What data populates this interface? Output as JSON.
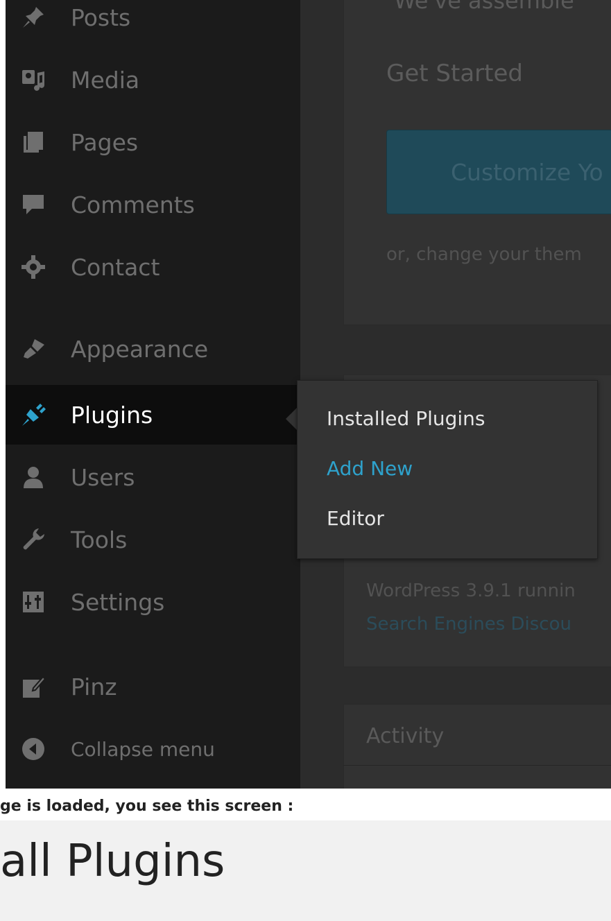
{
  "sidebar": {
    "items": [
      {
        "label": "Posts",
        "icon": "pin-icon"
      },
      {
        "label": "Media",
        "icon": "media-icon"
      },
      {
        "label": "Pages",
        "icon": "pages-icon"
      },
      {
        "label": "Comments",
        "icon": "comment-icon"
      },
      {
        "label": "Contact",
        "icon": "gear-icon"
      },
      {
        "label": "Appearance",
        "icon": "brush-icon"
      },
      {
        "label": "Plugins",
        "icon": "plugin-icon",
        "active": true
      },
      {
        "label": "Users",
        "icon": "user-icon"
      },
      {
        "label": "Tools",
        "icon": "wrench-icon"
      },
      {
        "label": "Settings",
        "icon": "settings-icon"
      },
      {
        "label": "Pinz",
        "icon": "edit-icon"
      },
      {
        "label": "Collapse menu",
        "icon": "collapse-icon"
      }
    ]
  },
  "flyout": {
    "items": [
      "Installed Plugins",
      "Add New",
      "Editor"
    ]
  },
  "main": {
    "top_cut": "We've assemble",
    "get_started": "Get Started",
    "customize": "Customize Yo",
    "or_change": "or, change your them",
    "wp_version": "WordPress 3.9.1 runnin",
    "search_engines": "Search Engines Discou",
    "activity": "Activity"
  },
  "caption": "ge is loaded, you see this screen :",
  "heading": "all Plugins",
  "colors": {
    "accent": "#2ea2cc",
    "sidebar": "#1b1b1b",
    "icon": "#6f6f6f"
  }
}
